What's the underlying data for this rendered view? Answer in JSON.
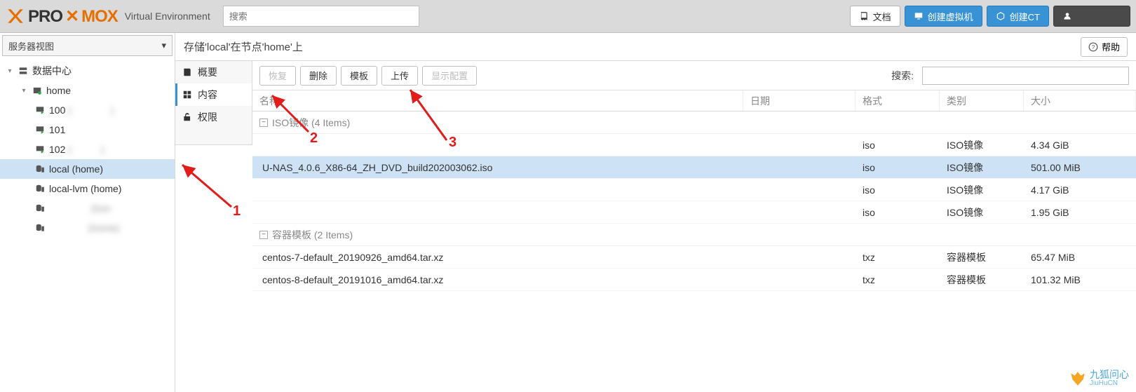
{
  "header": {
    "logo_a": "PRO",
    "logo_b": "MOX",
    "ve_label": "Virtual Environment",
    "search_placeholder": "搜索",
    "docs_label": "文档",
    "create_vm_label": "创建虚拟机",
    "create_ct_label": "创建CT",
    "user_label": "　　　　"
  },
  "sidebar": {
    "view_label": "服务器视图",
    "datacenter_label": "数据中心",
    "node_label": "home",
    "vms": [
      {
        "id": "100",
        "desc": "(　　　　)"
      },
      {
        "id": "101",
        "desc": "　　　　"
      },
      {
        "id": "102",
        "desc": "(　　　)"
      }
    ],
    "storages": [
      {
        "label": "local (home)",
        "selected": true
      },
      {
        "label": "local-lvm (home)",
        "selected": false
      },
      {
        "label": "　　　　 (hon",
        "selected": false,
        "blurred": true
      },
      {
        "label": "　　　　(home)",
        "selected": false,
        "blurred": true
      }
    ]
  },
  "panel": {
    "title": "存储'local'在节点'home'上",
    "help_label": "帮助",
    "subnav": {
      "summary": "概要",
      "content": "内容",
      "perms": "权限"
    },
    "toolbar": {
      "restore": "恢复",
      "delete": "删除",
      "template": "模板",
      "upload": "上传",
      "showconfig": "显示配置",
      "search_label": "搜索:"
    },
    "columns": {
      "name": "名称",
      "date": "日期",
      "format": "格式",
      "type": "类别",
      "size": "大小"
    },
    "groups": [
      {
        "header": "ISO镜像 (4 Items)",
        "rows": [
          {
            "name": "　　　　　　　　　　　　",
            "date": "",
            "format": "iso",
            "type": "ISO镜像",
            "size": "4.34 GiB",
            "blurred": true
          },
          {
            "name": "U-NAS_4.0.6_X86-64_ZH_DVD_build202003062.iso",
            "date": "",
            "format": "iso",
            "type": "ISO镜像",
            "size": "501.00 MiB",
            "selected": true
          },
          {
            "name": "　　　　　　　　　　　　　　　　　　　　",
            "date": "",
            "format": "iso",
            "type": "ISO镜像",
            "size": "4.17 GiB",
            "blurred": true
          },
          {
            "name": "　　　　　　　　　　　　",
            "date": "",
            "format": "iso",
            "type": "ISO镜像",
            "size": "1.95 GiB",
            "blurred": true
          }
        ]
      },
      {
        "header": "容器模板 (2 Items)",
        "rows": [
          {
            "name": "centos-7-default_20190926_amd64.tar.xz",
            "date": "",
            "format": "txz",
            "type": "容器模板",
            "size": "65.47 MiB"
          },
          {
            "name": "centos-8-default_20191016_amd64.tar.xz",
            "date": "",
            "format": "txz",
            "type": "容器模板",
            "size": "101.32 MiB"
          }
        ]
      }
    ]
  },
  "annotations": {
    "l1": "1",
    "l2": "2",
    "l3": "3"
  },
  "watermark": {
    "cn": "九狐问心",
    "en": "JiuHuCN"
  }
}
